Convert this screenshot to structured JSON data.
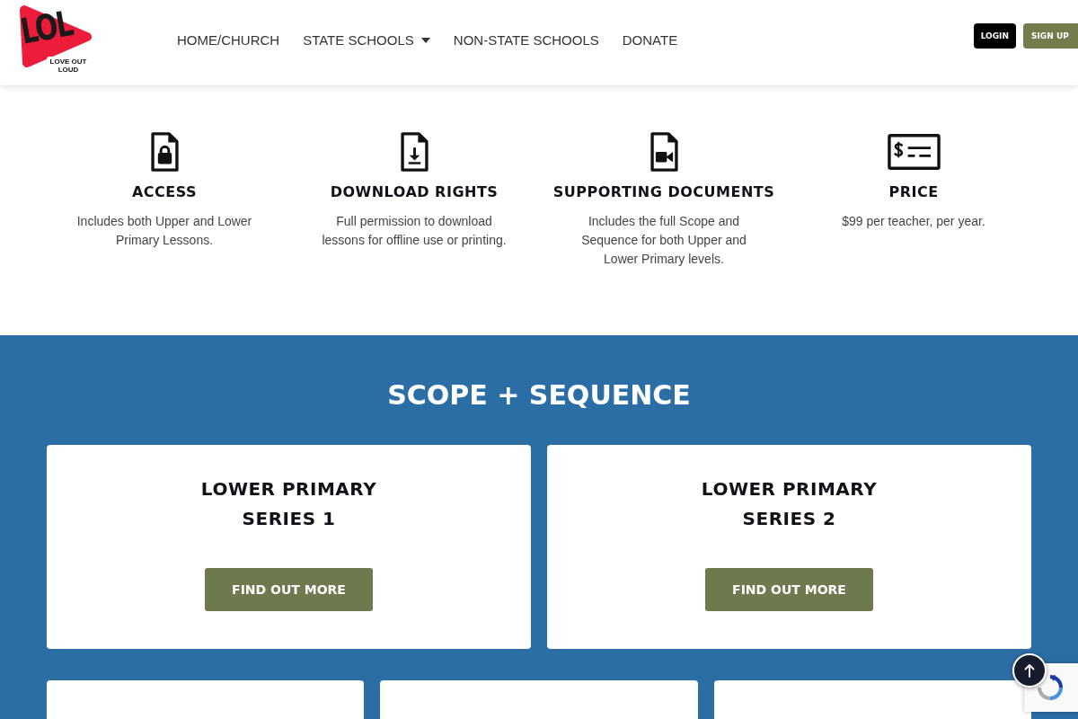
{
  "header": {
    "logo": {
      "mark": "LOL",
      "tagline": "LOVE OUT LOUD"
    },
    "nav": [
      {
        "label": "HOME/CHURCH",
        "has_dropdown": false
      },
      {
        "label": "STATE SCHOOLS",
        "has_dropdown": true
      },
      {
        "label": "NON-STATE SCHOOLS",
        "has_dropdown": false
      },
      {
        "label": "DONATE",
        "has_dropdown": false
      }
    ],
    "buttons": [
      {
        "label": "LOGIN",
        "kind": "login"
      },
      {
        "label": "SIGN UP",
        "kind": "signup"
      }
    ]
  },
  "features": [
    {
      "title": "ACCESS",
      "text": "Includes both Upper and Lower Primary Lessons."
    },
    {
      "title": "DOWNLOAD RIGHTS",
      "text": "Full permission to download lessons for offline use or printing."
    },
    {
      "title": "SUPPORTING DOCUMENTS",
      "text": "Includes the full Scope and Sequence for both Upper and Lower Primary levels."
    },
    {
      "title": "PRICE",
      "text": "$99 per teacher, per year."
    }
  ],
  "scope_section": {
    "title": "SCOPE + SEQUENCE",
    "cards": [
      {
        "title": "LOWER PRIMARY SERIES 1",
        "button": "FIND OUT MORE"
      },
      {
        "title": "LOWER PRIMARY SERIES 2",
        "button": "FIND OUT MORE"
      }
    ]
  }
}
